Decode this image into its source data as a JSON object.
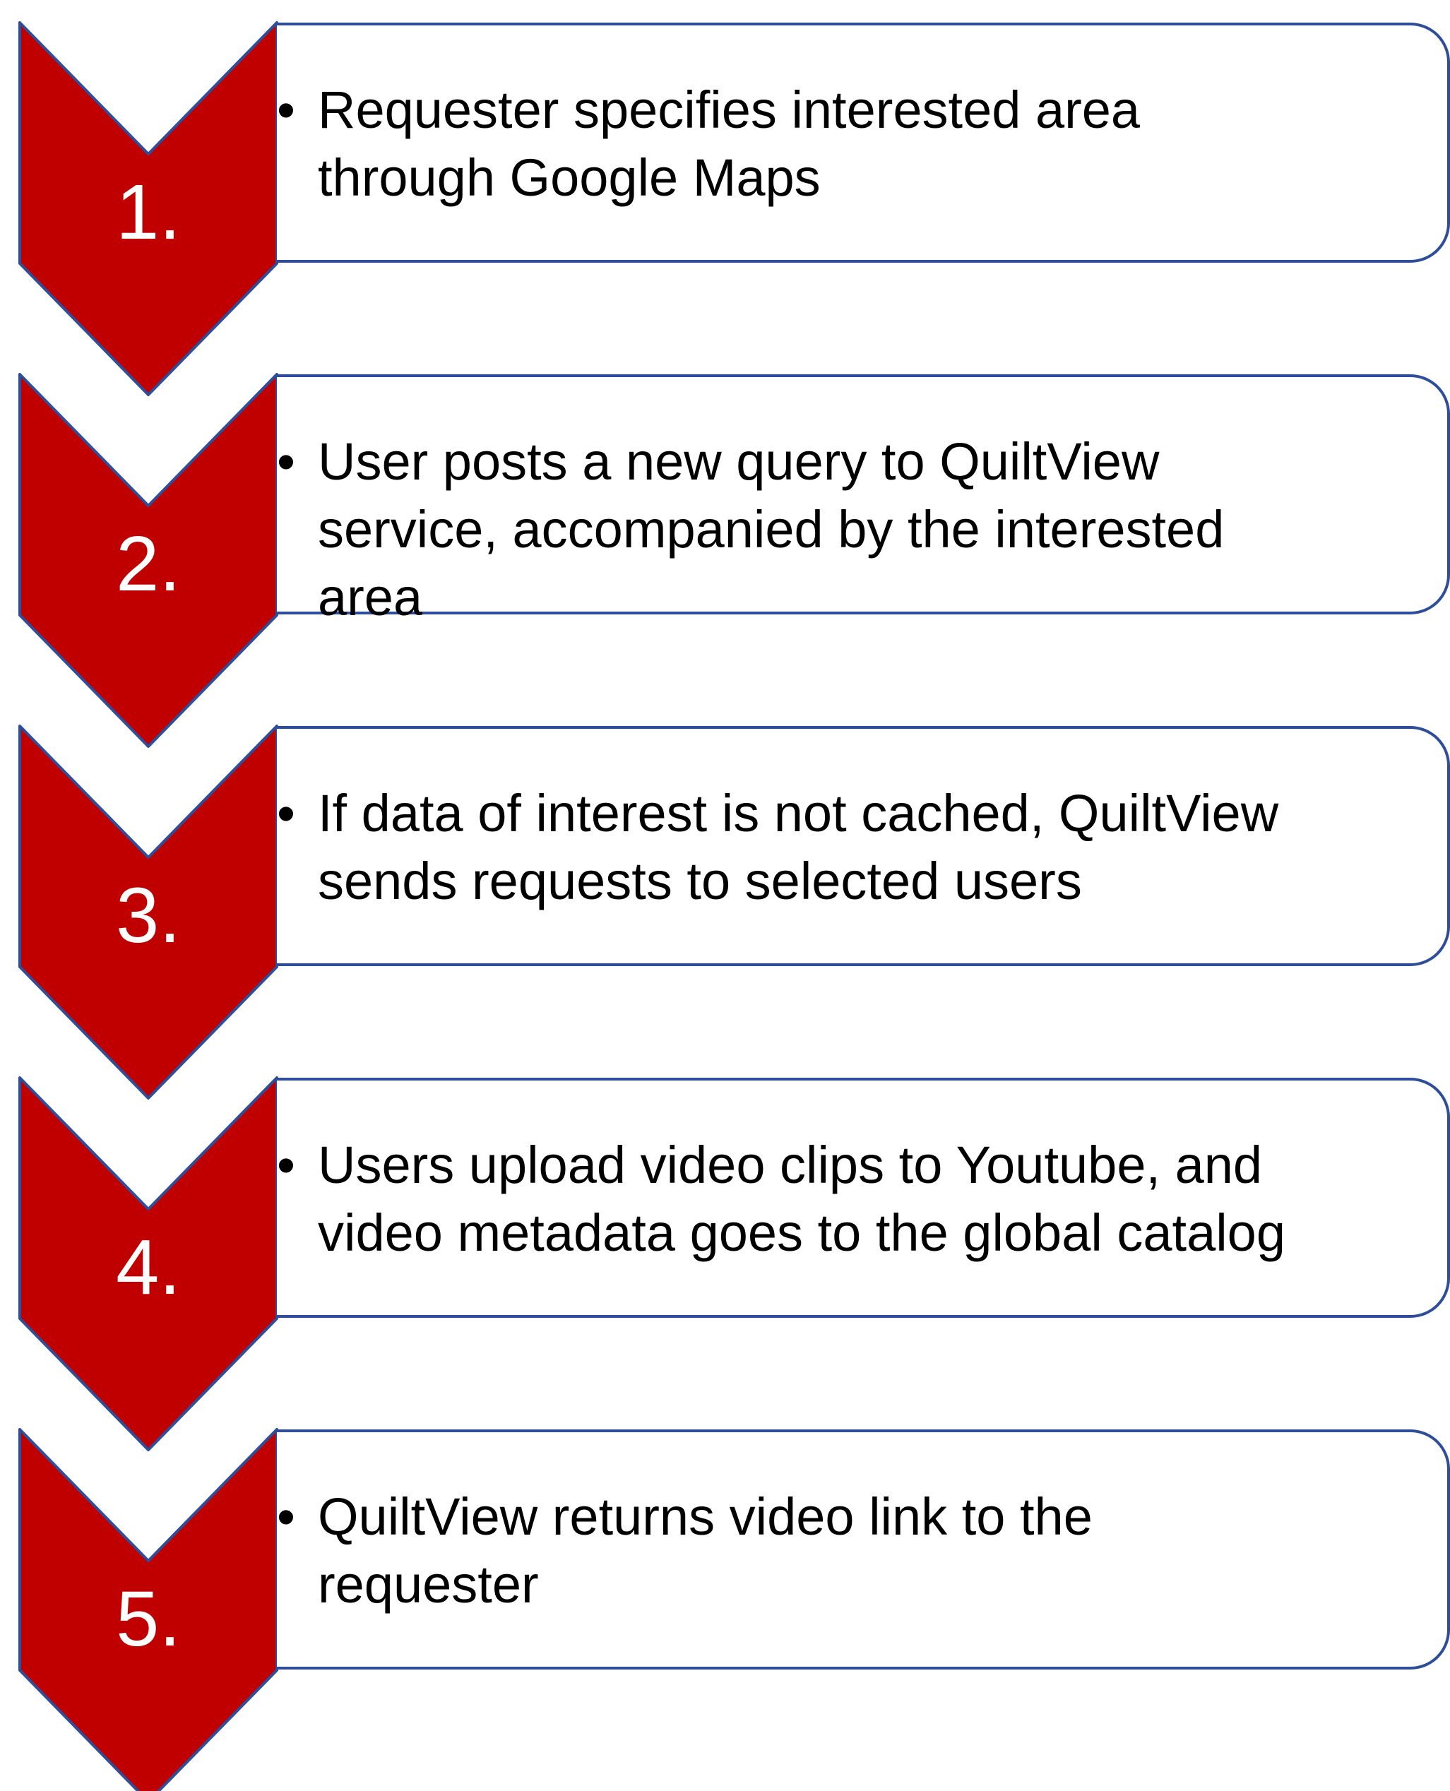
{
  "colors": {
    "chevron_fill": "#C00000",
    "chevron_stroke": "#2E4E9A",
    "box_stroke": "#2E4E9A",
    "number_text": "#FFFFFF"
  },
  "bullet_glyph": "•",
  "steps": [
    {
      "number": "1.",
      "lines": [
        "Requester specifies interested area",
        "through Google Maps"
      ]
    },
    {
      "number": "2.",
      "lines": [
        "User posts a new query to QuiltView",
        "service, accompanied by the interested",
        "area"
      ]
    },
    {
      "number": "3.",
      "lines": [
        "If data of interest is not cached, QuiltView",
        "sends requests to selected users"
      ]
    },
    {
      "number": "4.",
      "lines": [
        "Users upload video clips to Youtube, and",
        "video metadata goes to the global catalog"
      ]
    },
    {
      "number": "5.",
      "lines": [
        "QuiltView returns video link to the",
        "requester"
      ]
    }
  ]
}
